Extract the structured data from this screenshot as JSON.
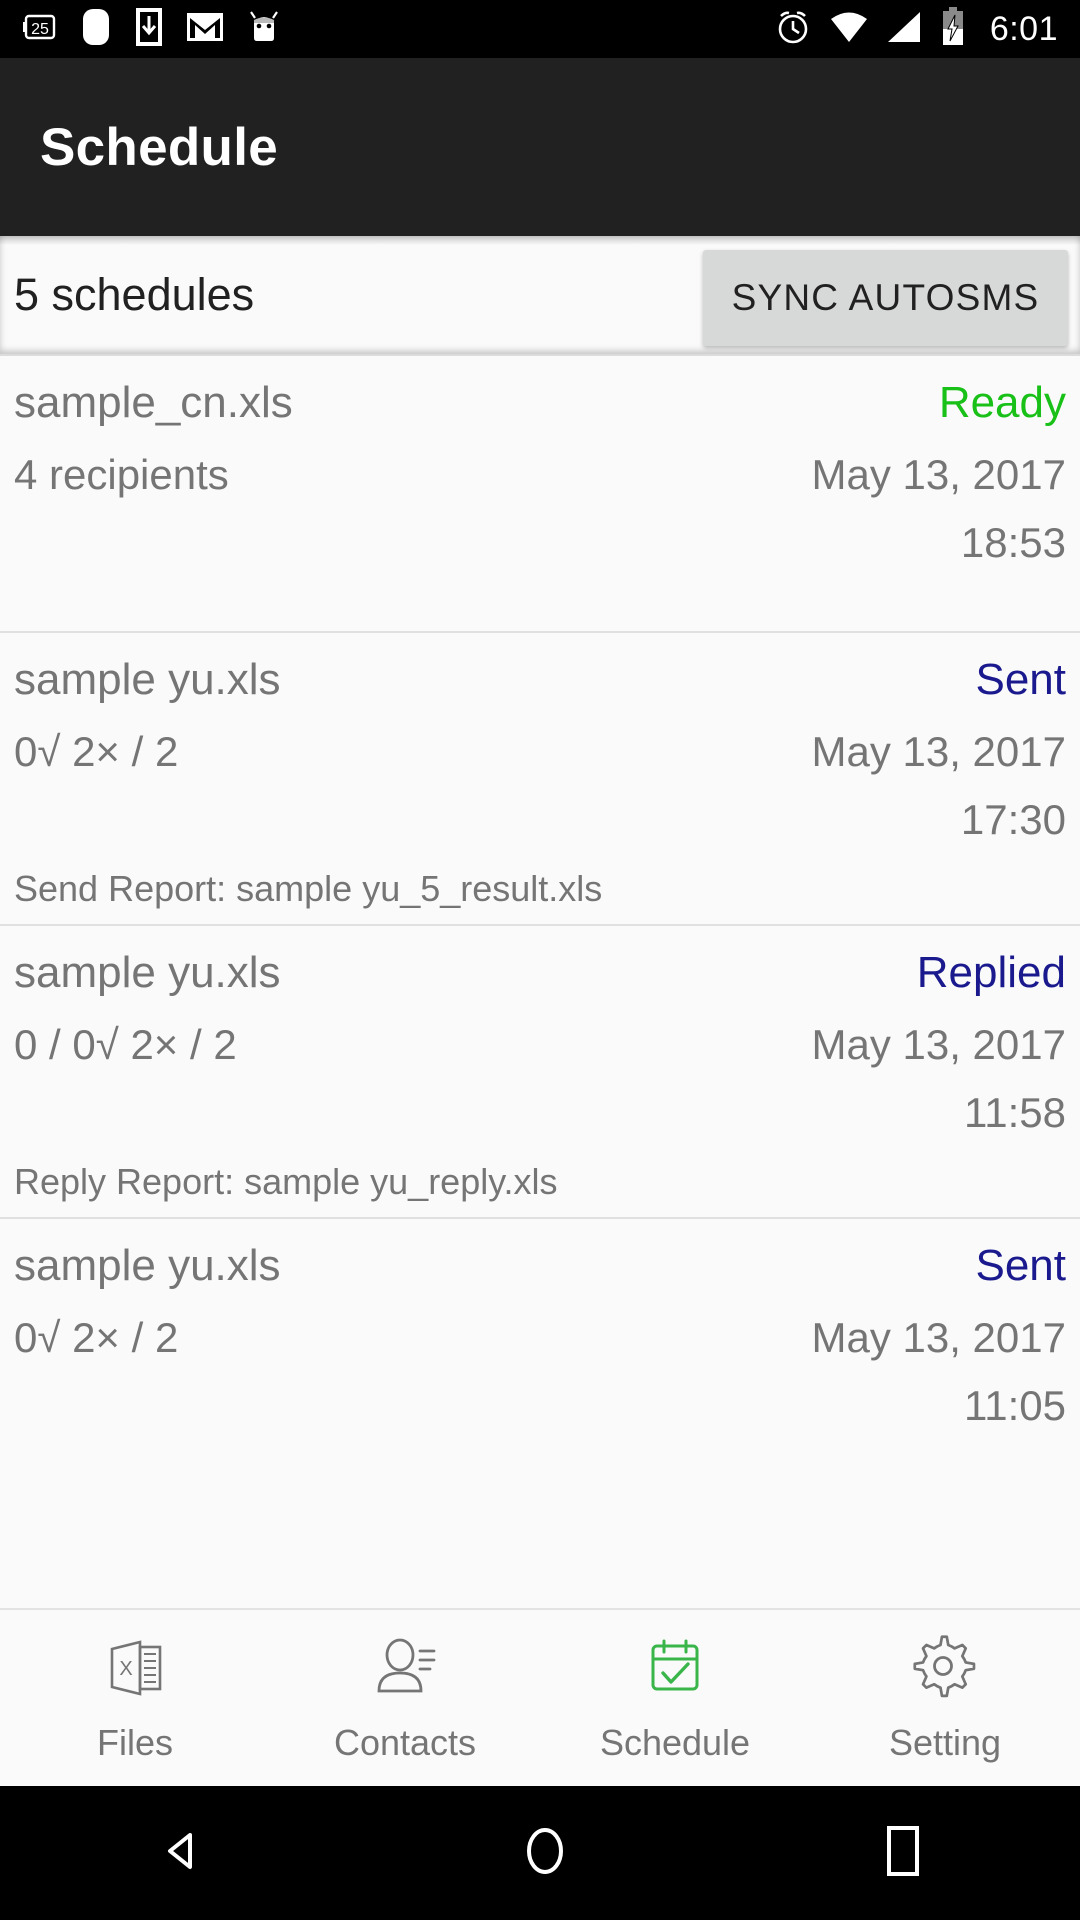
{
  "status_bar": {
    "time": "6:01",
    "left_icons": [
      "calendar-25-icon",
      "rounded-square-icon",
      "download-icon",
      "gmail-icon",
      "android-robot-icon"
    ],
    "calendar_day": "25",
    "right_icons": [
      "alarm-icon",
      "wifi-icon",
      "signal-icon",
      "battery-charging-icon"
    ]
  },
  "app_bar": {
    "title": "Schedule"
  },
  "subheader": {
    "count_label": "5 schedules",
    "sync_button": "SYNC AUTOSMS"
  },
  "colors": {
    "appbar_bg": "#212121",
    "page_bg": "#fafafa",
    "ready_green": "#18c018",
    "status_navy": "#1a1a8e",
    "muted_text": "#757575",
    "button_bg": "#d7d8d8",
    "active_tab_green": "#3ab54a"
  },
  "schedules": [
    {
      "file_name": "sample_cn.xls",
      "status": "Ready",
      "status_kind": "ready",
      "counts": "4 recipients",
      "date": "May 13, 2017",
      "time": "18:53",
      "report": ""
    },
    {
      "file_name": "sample yu.xls",
      "status": "Sent",
      "status_kind": "sent",
      "counts": "0√ 2× / 2",
      "date": "May 13, 2017",
      "time": "17:30",
      "report": "Send Report: sample yu_5_result.xls"
    },
    {
      "file_name": "sample yu.xls",
      "status": "Replied",
      "status_kind": "replied",
      "counts": "0 / 0√ 2× / 2",
      "date": "May 13, 2017",
      "time": "11:58",
      "report": "Reply Report: sample yu_reply.xls"
    },
    {
      "file_name": "sample yu.xls",
      "status": "Sent",
      "status_kind": "sent",
      "counts": "0√ 2× / 2",
      "date": "May 13, 2017",
      "time": "11:05",
      "report": ""
    }
  ],
  "tab_bar": {
    "items": [
      {
        "label": "Files",
        "icon": "excel-file-icon",
        "active": false
      },
      {
        "label": "Contacts",
        "icon": "contacts-icon",
        "active": false
      },
      {
        "label": "Schedule",
        "icon": "calendar-check-icon",
        "active": true
      },
      {
        "label": "Setting",
        "icon": "gear-icon",
        "active": false
      }
    ]
  },
  "nav_bar": {
    "items": [
      "back-triangle-icon",
      "home-circle-icon",
      "recents-square-icon"
    ]
  }
}
